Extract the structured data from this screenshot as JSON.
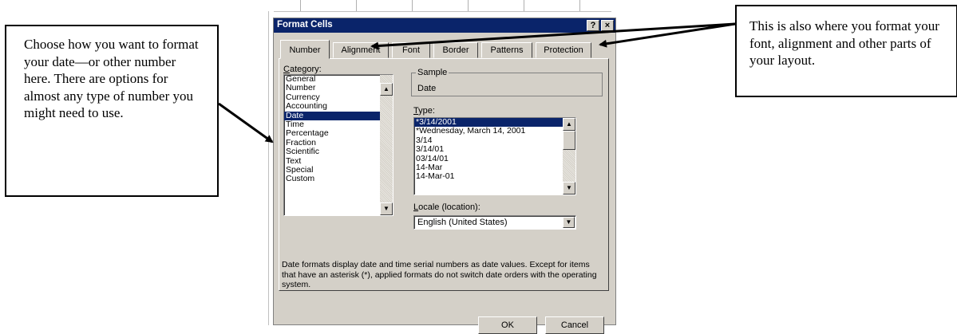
{
  "callouts": {
    "left_text": "Choose how you want to format your date—or other number here. There are options for almost any type of number you might need to use.",
    "right_text": "This is also where you format your font, alignment and other parts of your layout."
  },
  "dialog": {
    "title": "Format Cells",
    "help_label": "?",
    "close_label": "×",
    "tabs": [
      {
        "label": "Number"
      },
      {
        "label": "Alignment"
      },
      {
        "label": "Font"
      },
      {
        "label": "Border"
      },
      {
        "label": "Patterns"
      },
      {
        "label": "Protection"
      }
    ],
    "category": {
      "label_underlined": "C",
      "label_rest": "ategory:",
      "items": [
        "General",
        "Number",
        "Currency",
        "Accounting",
        "Date",
        "Time",
        "Percentage",
        "Fraction",
        "Scientific",
        "Text",
        "Special",
        "Custom"
      ],
      "selected": "Date"
    },
    "sample": {
      "legend": "Sample",
      "value": "Date"
    },
    "type": {
      "label_underlined": "T",
      "label_rest": "ype:",
      "items": [
        "*3/14/2001",
        "*Wednesday, March 14, 2001",
        "3/14",
        "3/14/01",
        "03/14/01",
        "14-Mar",
        "14-Mar-01"
      ],
      "selected": "*3/14/2001"
    },
    "locale": {
      "label_underlined": "L",
      "label_rest": "ocale (location):",
      "value": "English (United States)"
    },
    "description": "Date formats display date and time serial numbers as date values. Except for items that have an asterisk (*), applied formats do not switch date orders with the operating system.",
    "buttons": {
      "ok": "OK",
      "cancel": "Cancel"
    }
  },
  "icons": {
    "scroll_up": "scroll-up-arrow-icon",
    "scroll_down": "scroll-down-arrow-icon",
    "dropdown": "dropdown-arrow-icon"
  }
}
